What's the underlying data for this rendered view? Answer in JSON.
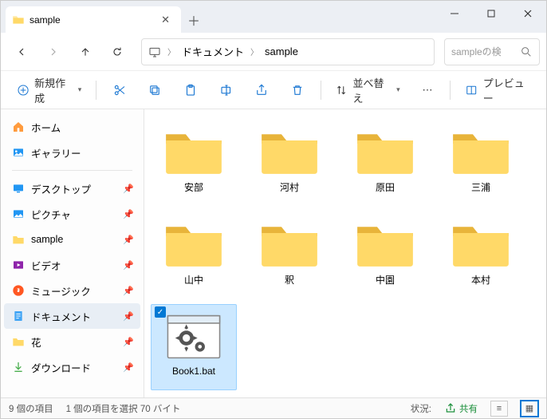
{
  "titlebar": {
    "tab_title": "sample"
  },
  "address": {
    "crumb1": "ドキュメント",
    "crumb2": "sample"
  },
  "search": {
    "placeholder": "sampleの検"
  },
  "toolbar": {
    "new": "新規作成",
    "sort": "並べ替え",
    "preview": "プレビュー"
  },
  "sidebar": {
    "home": "ホーム",
    "gallery": "ギャラリー",
    "desktop": "デスクトップ",
    "pictures": "ピクチャ",
    "sample": "sample",
    "videos": "ビデオ",
    "music": "ミュージック",
    "documents": "ドキュメント",
    "flower": "花",
    "downloads": "ダウンロード"
  },
  "items": {
    "f0": "安部",
    "f1": "河村",
    "f2": "原田",
    "f3": "三浦",
    "f4": "山中",
    "f5": "釈",
    "f6": "中園",
    "f7": "本村",
    "bat": "Book1.bat"
  },
  "status": {
    "count": "9 個の項目",
    "selected": "1 個の項目を選択 70 バイト",
    "state_label": "状況:",
    "shared": "共有"
  }
}
